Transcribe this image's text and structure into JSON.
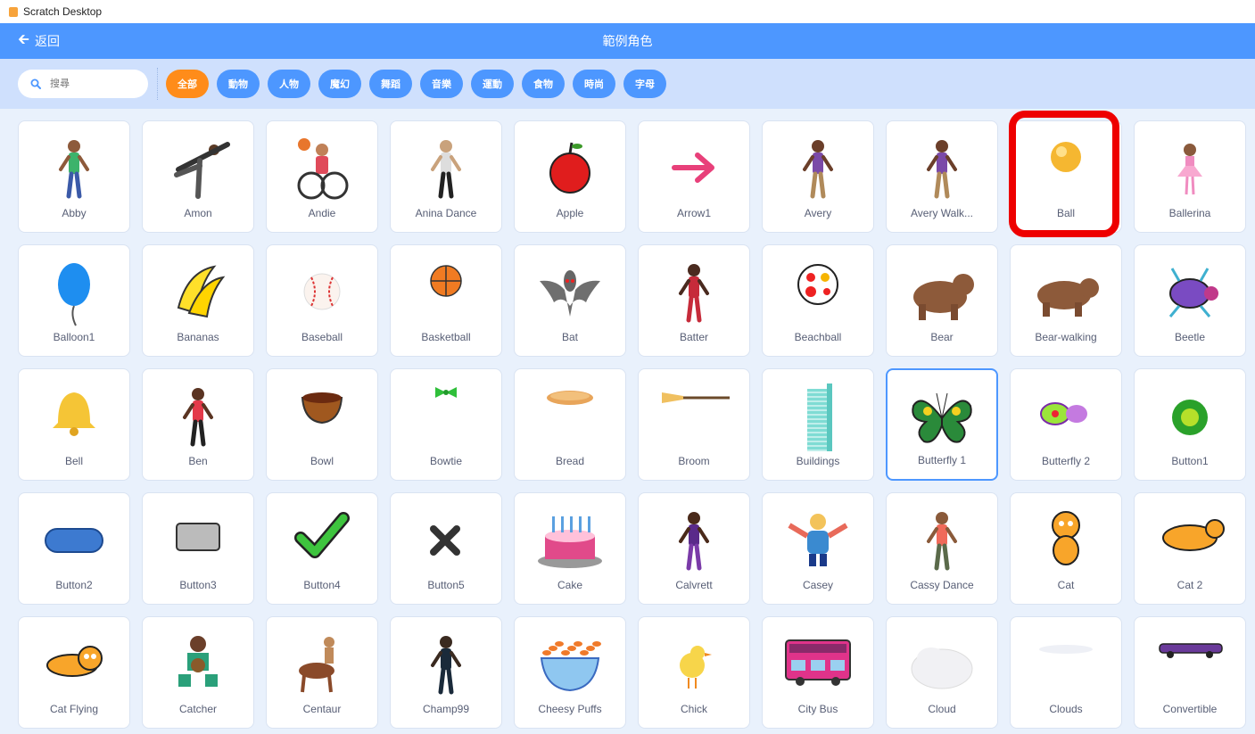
{
  "window": {
    "title": "Scratch Desktop"
  },
  "header": {
    "back_label": "返回",
    "title": "範例角色"
  },
  "search": {
    "placeholder": "搜尋"
  },
  "tags": [
    "全部",
    "動物",
    "人物",
    "魔幻",
    "舞蹈",
    "音樂",
    "運動",
    "食物",
    "時尚",
    "字母"
  ],
  "active_tag": "全部",
  "selected_sprite": "Butterfly 1",
  "highlighted_sprite": "Ball",
  "highlight_color": "#ee0000",
  "accent_color": "#4d97ff",
  "sprites": [
    {
      "name": "Abby",
      "icon": "abby"
    },
    {
      "name": "Amon",
      "icon": "amon"
    },
    {
      "name": "Andie",
      "icon": "andie"
    },
    {
      "name": "Anina Dance",
      "icon": "anina-dance"
    },
    {
      "name": "Apple",
      "icon": "apple"
    },
    {
      "name": "Arrow1",
      "icon": "arrow"
    },
    {
      "name": "Avery",
      "icon": "avery"
    },
    {
      "name": "Avery Walk...",
      "icon": "avery-walking"
    },
    {
      "name": "Ball",
      "icon": "ball"
    },
    {
      "name": "Ballerina",
      "icon": "ballerina"
    },
    {
      "name": "Balloon1",
      "icon": "balloon"
    },
    {
      "name": "Bananas",
      "icon": "bananas"
    },
    {
      "name": "Baseball",
      "icon": "baseball"
    },
    {
      "name": "Basketball",
      "icon": "basketball"
    },
    {
      "name": "Bat",
      "icon": "bat"
    },
    {
      "name": "Batter",
      "icon": "batter"
    },
    {
      "name": "Beachball",
      "icon": "beachball"
    },
    {
      "name": "Bear",
      "icon": "bear"
    },
    {
      "name": "Bear-walking",
      "icon": "bear-walking"
    },
    {
      "name": "Beetle",
      "icon": "beetle"
    },
    {
      "name": "Bell",
      "icon": "bell"
    },
    {
      "name": "Ben",
      "icon": "ben"
    },
    {
      "name": "Bowl",
      "icon": "bowl"
    },
    {
      "name": "Bowtie",
      "icon": "bowtie"
    },
    {
      "name": "Bread",
      "icon": "bread"
    },
    {
      "name": "Broom",
      "icon": "broom"
    },
    {
      "name": "Buildings",
      "icon": "buildings"
    },
    {
      "name": "Butterfly 1",
      "icon": "butterfly1"
    },
    {
      "name": "Butterfly 2",
      "icon": "butterfly2"
    },
    {
      "name": "Button1",
      "icon": "button1"
    },
    {
      "name": "Button2",
      "icon": "button2"
    },
    {
      "name": "Button3",
      "icon": "button3"
    },
    {
      "name": "Button4",
      "icon": "button4"
    },
    {
      "name": "Button5",
      "icon": "button5"
    },
    {
      "name": "Cake",
      "icon": "cake"
    },
    {
      "name": "Calvrett",
      "icon": "calvrett"
    },
    {
      "name": "Casey",
      "icon": "casey"
    },
    {
      "name": "Cassy Dance",
      "icon": "cassy-dance"
    },
    {
      "name": "Cat",
      "icon": "cat"
    },
    {
      "name": "Cat 2",
      "icon": "cat2"
    },
    {
      "name": "Cat Flying",
      "icon": "cat-flying"
    },
    {
      "name": "Catcher",
      "icon": "catcher"
    },
    {
      "name": "Centaur",
      "icon": "centaur"
    },
    {
      "name": "Champ99",
      "icon": "champ99"
    },
    {
      "name": "Cheesy Puffs",
      "icon": "cheesy-puffs"
    },
    {
      "name": "Chick",
      "icon": "chick"
    },
    {
      "name": "City Bus",
      "icon": "city-bus"
    },
    {
      "name": "Cloud",
      "icon": "cloud"
    },
    {
      "name": "Clouds",
      "icon": "clouds"
    },
    {
      "name": "Convertible",
      "icon": "convertible"
    }
  ]
}
